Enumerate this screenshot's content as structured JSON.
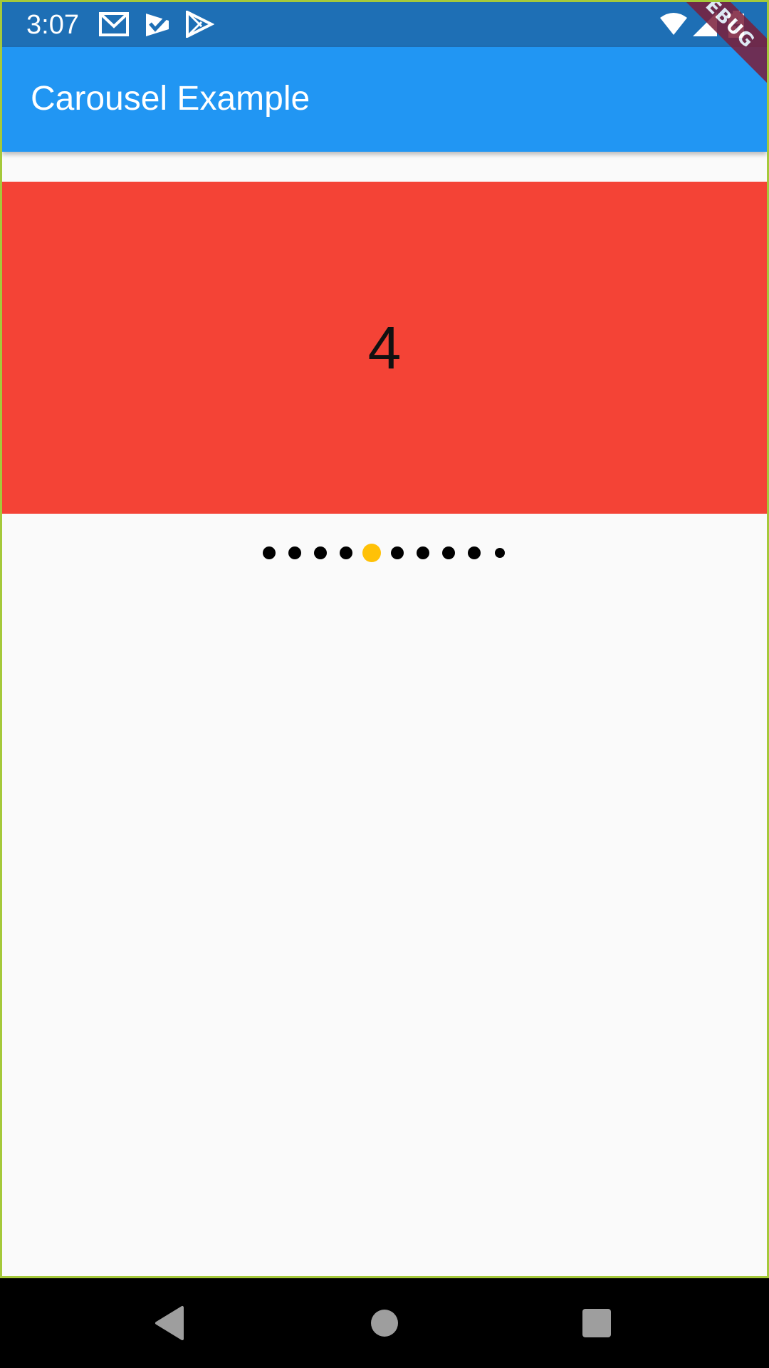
{
  "status_bar": {
    "time": "3:07",
    "left_icons": [
      "gmail-icon",
      "task-check-icon",
      "play-store-icon"
    ],
    "right_icons": [
      "wifi-icon",
      "signal-icon",
      "battery-charging-icon"
    ],
    "background": "#1e6fb5"
  },
  "app_bar": {
    "title": "Carousel Example",
    "background": "#2196f3"
  },
  "debug_banner": {
    "label": "EBUG"
  },
  "carousel": {
    "current_slide_label": "4",
    "slide_color": "#f44336",
    "active_index": 4,
    "total_slides": 10,
    "dot_color": "#000000",
    "active_dot_color": "#ffc107"
  },
  "nav_bar": {
    "buttons": [
      "back-icon",
      "home-icon",
      "recents-icon"
    ]
  }
}
